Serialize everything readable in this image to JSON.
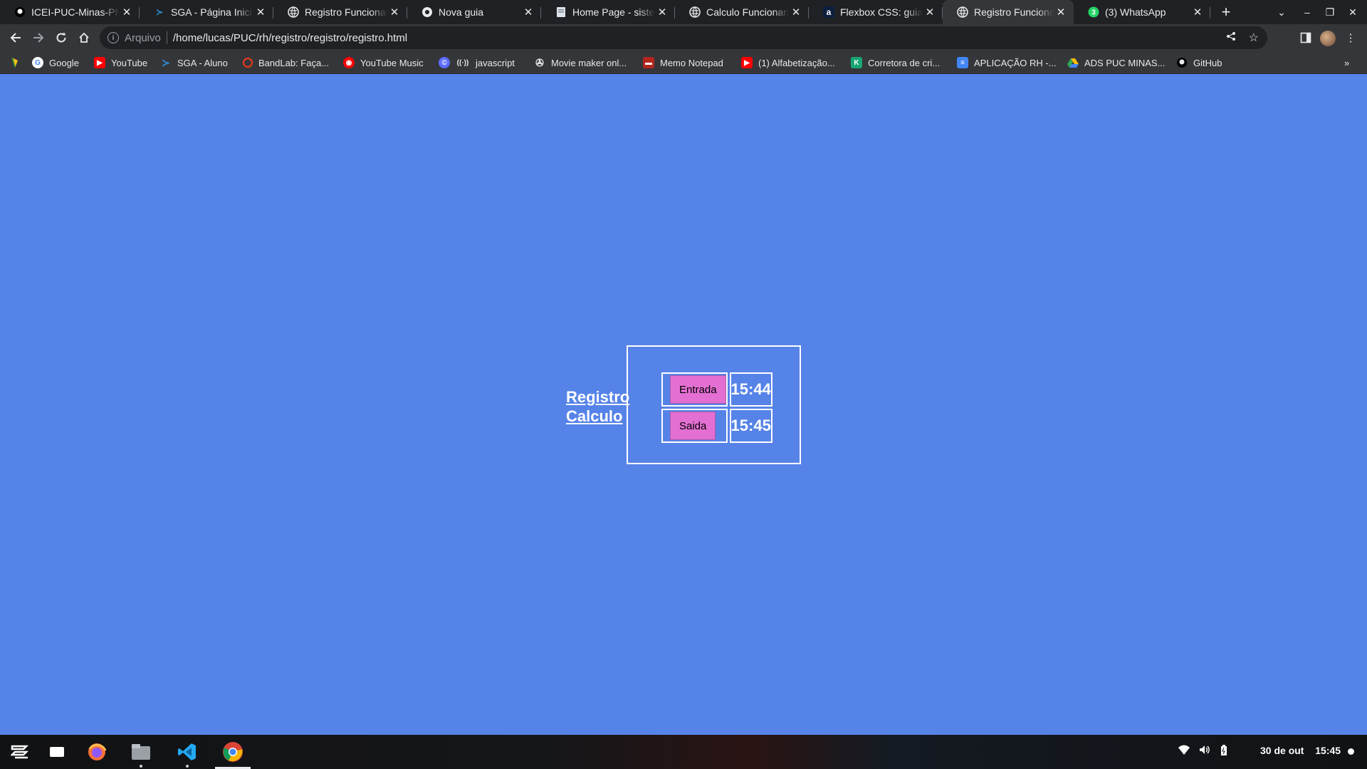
{
  "browser": {
    "tabs": [
      {
        "title": "ICEI-PUC-Minas-PM",
        "icon": "github-icon",
        "active": false
      },
      {
        "title": "SGA - Página Inicial",
        "icon": "sga-icon",
        "active": false
      },
      {
        "title": "Registro Funcionario",
        "icon": "globe-icon",
        "active": false
      },
      {
        "title": "Nova guia",
        "icon": "chrome-icon",
        "active": false
      },
      {
        "title": "Home Page - sistema",
        "icon": "document-icon",
        "active": false
      },
      {
        "title": "Calculo Funcionario",
        "icon": "globe-icon",
        "active": false
      },
      {
        "title": "Flexbox CSS: guia c",
        "icon": "alura-icon",
        "active": false
      },
      {
        "title": "Registro Funcionario",
        "icon": "globe-icon",
        "active": true
      },
      {
        "title": "(3) WhatsApp",
        "icon": "whatsapp-icon",
        "active": false
      }
    ],
    "address": {
      "scheme_label": "Arquivo",
      "url": "/home/lucas/PUC/rh/registro/registro/registro.html"
    },
    "bookmarks": [
      {
        "label": "Google",
        "icon": "google-icon"
      },
      {
        "label": "YouTube",
        "icon": "youtube-icon"
      },
      {
        "label": "SGA - Aluno",
        "icon": "sga-icon"
      },
      {
        "label": "BandLab: Faça...",
        "icon": "bandlab-icon"
      },
      {
        "label": "YouTube Music",
        "icon": "youtube-music-icon"
      },
      {
        "label": "javascript",
        "icon": "javascript-icon"
      },
      {
        "label": "Movie maker onl...",
        "icon": "movie-maker-icon"
      },
      {
        "label": "Memo Notepad",
        "icon": "memo-icon"
      },
      {
        "label": "(1) Alfabetização...",
        "icon": "youtube-icon"
      },
      {
        "label": "Corretora de cri...",
        "icon": "corretora-icon"
      },
      {
        "label": "APLICAÇÃO RH -...",
        "icon": "forms-icon"
      },
      {
        "label": "ADS PUC MINAS...",
        "icon": "drive-icon"
      },
      {
        "label": "GitHub",
        "icon": "github-icon"
      }
    ]
  },
  "page": {
    "nav_links": [
      "Registro",
      "Calculo"
    ],
    "rows": [
      {
        "button_label": "Entrada",
        "time": "15:44"
      },
      {
        "button_label": "Saida",
        "time": "15:45"
      }
    ],
    "background_color": "#5683e8",
    "button_color": "#e46fd3"
  },
  "taskbar": {
    "apps": [
      "launcher-icon",
      "files-window-icon",
      "firefox-icon",
      "file-manager-icon",
      "vscode-icon",
      "chrome-icon"
    ],
    "date": "30 de out",
    "time": "15:45"
  }
}
